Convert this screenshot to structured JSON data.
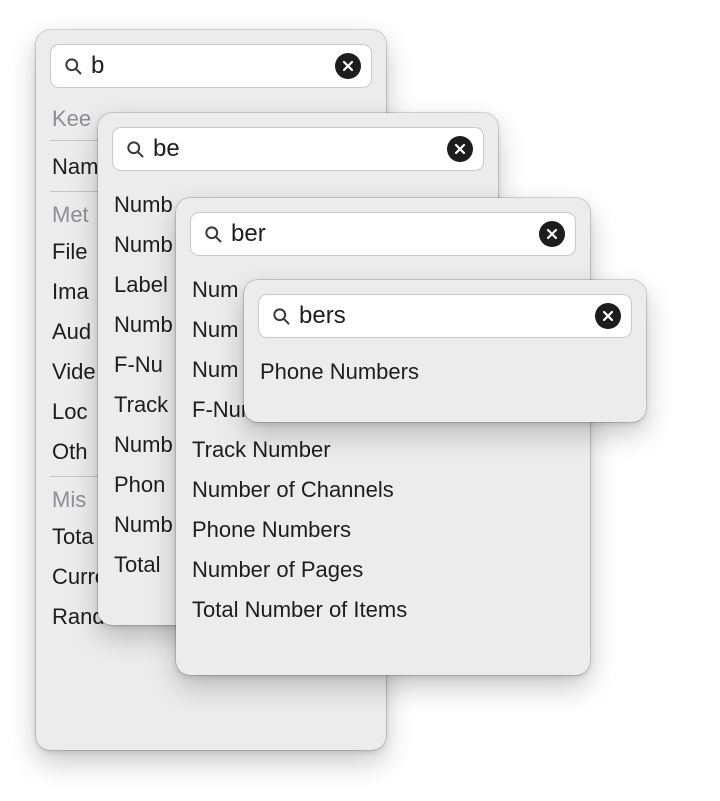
{
  "panels": [
    {
      "query": "b",
      "sections": [
        {
          "label": "Kee",
          "items": [
            "Name"
          ]
        },
        {
          "label": "Met",
          "items": [
            "File",
            "Ima",
            "Aud",
            "Vide",
            "Loc",
            "Oth"
          ]
        },
        {
          "label": "Mis",
          "items": [
            "Tota",
            "Current Date",
            "Random Characters"
          ]
        }
      ]
    },
    {
      "query": "be",
      "items": [
        "Numb",
        "Numb",
        "Label",
        "Numb",
        "F-Nu",
        "Track",
        "Numb",
        "Phon",
        "Numb",
        "Total"
      ]
    },
    {
      "query": "ber",
      "items": [
        "Num",
        "Num",
        "Num",
        "F-Number",
        "Track Number",
        "Number of Channels",
        "Phone Numbers",
        "Number of Pages",
        "Total Number of Items"
      ]
    },
    {
      "query": "bers",
      "items": [
        "Phone Numbers"
      ]
    }
  ]
}
